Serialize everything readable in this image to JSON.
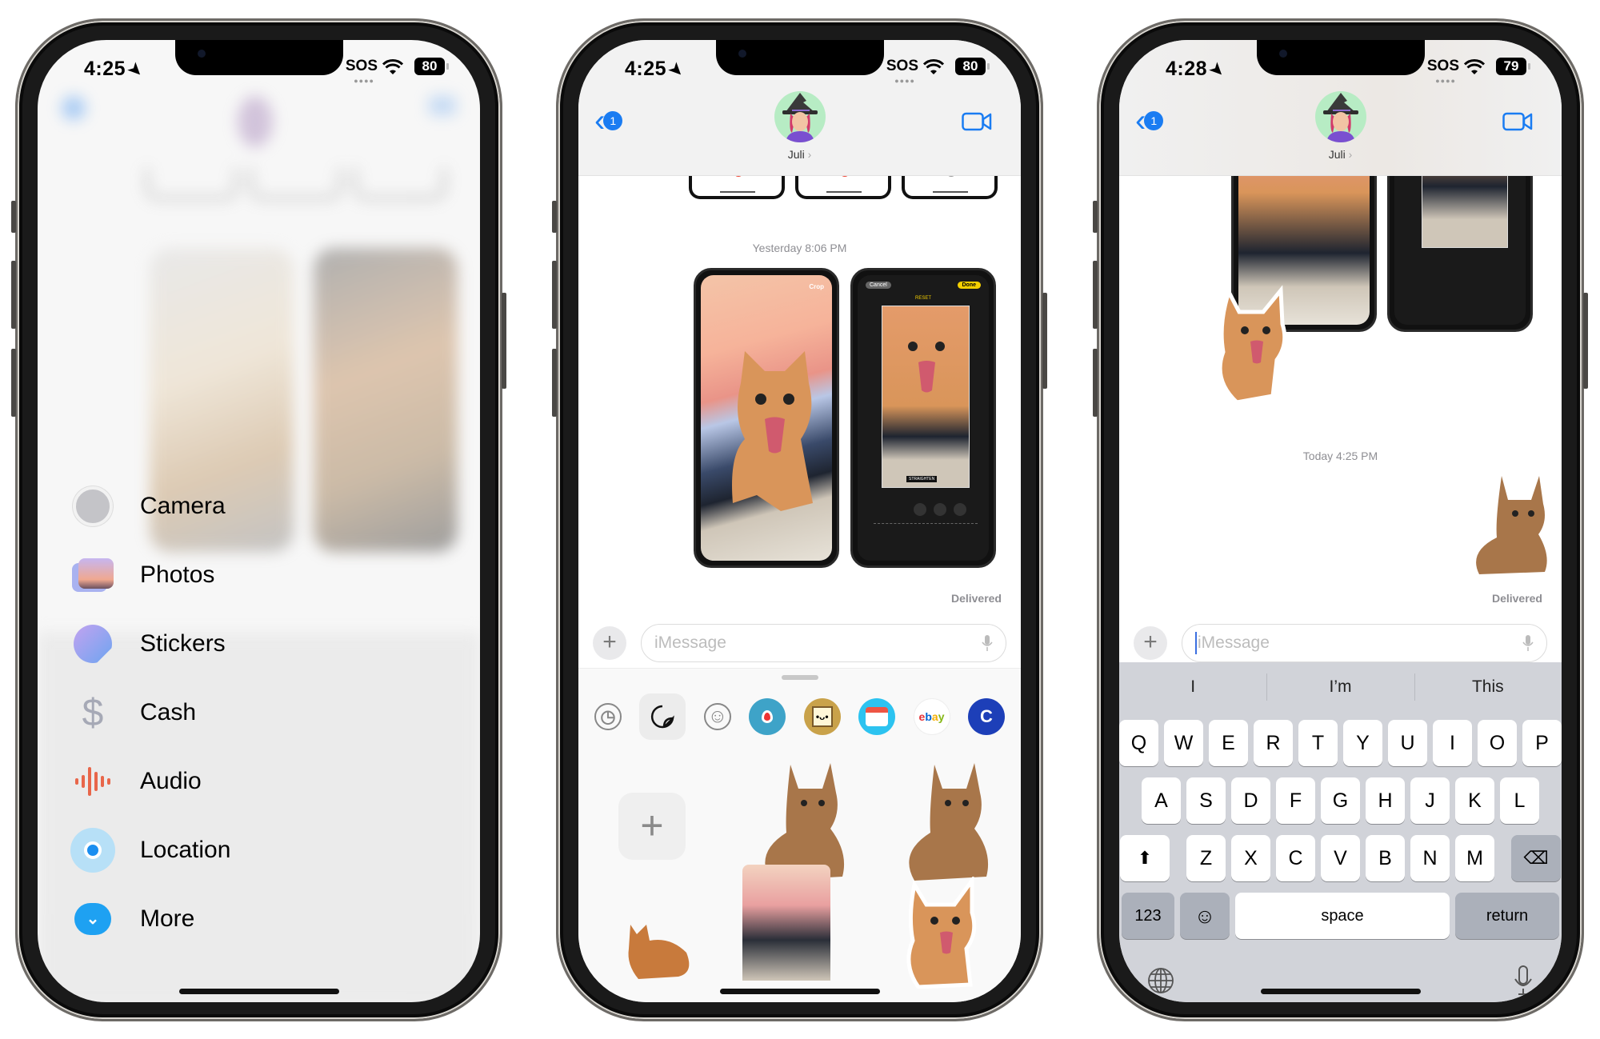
{
  "phones": [
    {
      "status": {
        "time": "4:25",
        "carrier": "SOS",
        "battery": "80"
      },
      "app_menu": {
        "items": [
          {
            "label": "Camera",
            "icon": "camera-icon"
          },
          {
            "label": "Photos",
            "icon": "photos-icon"
          },
          {
            "label": "Stickers",
            "icon": "stickers-icon"
          },
          {
            "label": "Cash",
            "icon": "cash-icon"
          },
          {
            "label": "Audio",
            "icon": "audio-icon"
          },
          {
            "label": "Location",
            "icon": "location-icon"
          },
          {
            "label": "More",
            "icon": "more-chevron-icon"
          }
        ]
      }
    },
    {
      "status": {
        "time": "4:25",
        "carrier": "SOS",
        "battery": "80"
      },
      "nav": {
        "back_badge": "1",
        "contact_name": "Juli"
      },
      "thread": {
        "timestamp": "Yesterday 8:06 PM",
        "delivered": "Delivered",
        "thumb_labels": {
          "crop": "Crop",
          "cancel": "Cancel",
          "done": "Done",
          "reset": "RESET",
          "straighten": "STRAIGHTEN"
        }
      },
      "composer": {
        "placeholder": "iMessage"
      },
      "drawer": {
        "apps": [
          {
            "name": "recents-icon",
            "glyph": "◷"
          },
          {
            "name": "stickers-app-icon",
            "glyph": "",
            "selected": true
          },
          {
            "name": "emoji-icon",
            "glyph": "☺"
          },
          {
            "name": "periscope-app-icon",
            "glyph": ""
          },
          {
            "name": "sticker-pack-app-icon",
            "glyph": ""
          },
          {
            "name": "calendar-app-icon",
            "glyph": ""
          },
          {
            "name": "ebay-app-icon",
            "glyph": "ebay"
          },
          {
            "name": "c-app-icon",
            "glyph": "C"
          }
        ],
        "add_sticker": "+"
      }
    },
    {
      "status": {
        "time": "4:28",
        "carrier": "SOS",
        "battery": "79"
      },
      "nav": {
        "back_badge": "1",
        "contact_name": "Juli"
      },
      "thread": {
        "timestamp": "Today 4:25 PM",
        "delivered": "Delivered"
      },
      "composer": {
        "placeholder": "iMessage"
      },
      "keyboard": {
        "predictions": [
          "I",
          "I’m",
          "This"
        ],
        "row1": [
          "Q",
          "W",
          "E",
          "R",
          "T",
          "Y",
          "U",
          "I",
          "O",
          "P"
        ],
        "row2": [
          "A",
          "S",
          "D",
          "F",
          "G",
          "H",
          "J",
          "K",
          "L"
        ],
        "row3": [
          "Z",
          "X",
          "C",
          "V",
          "B",
          "N",
          "M"
        ],
        "numbers": "123",
        "space": "space",
        "return": "return"
      }
    }
  ],
  "colors": {
    "accent": "#1a7cf2",
    "keyboard_bg": "#d1d3d9",
    "timestamp": "#8e8e93"
  }
}
